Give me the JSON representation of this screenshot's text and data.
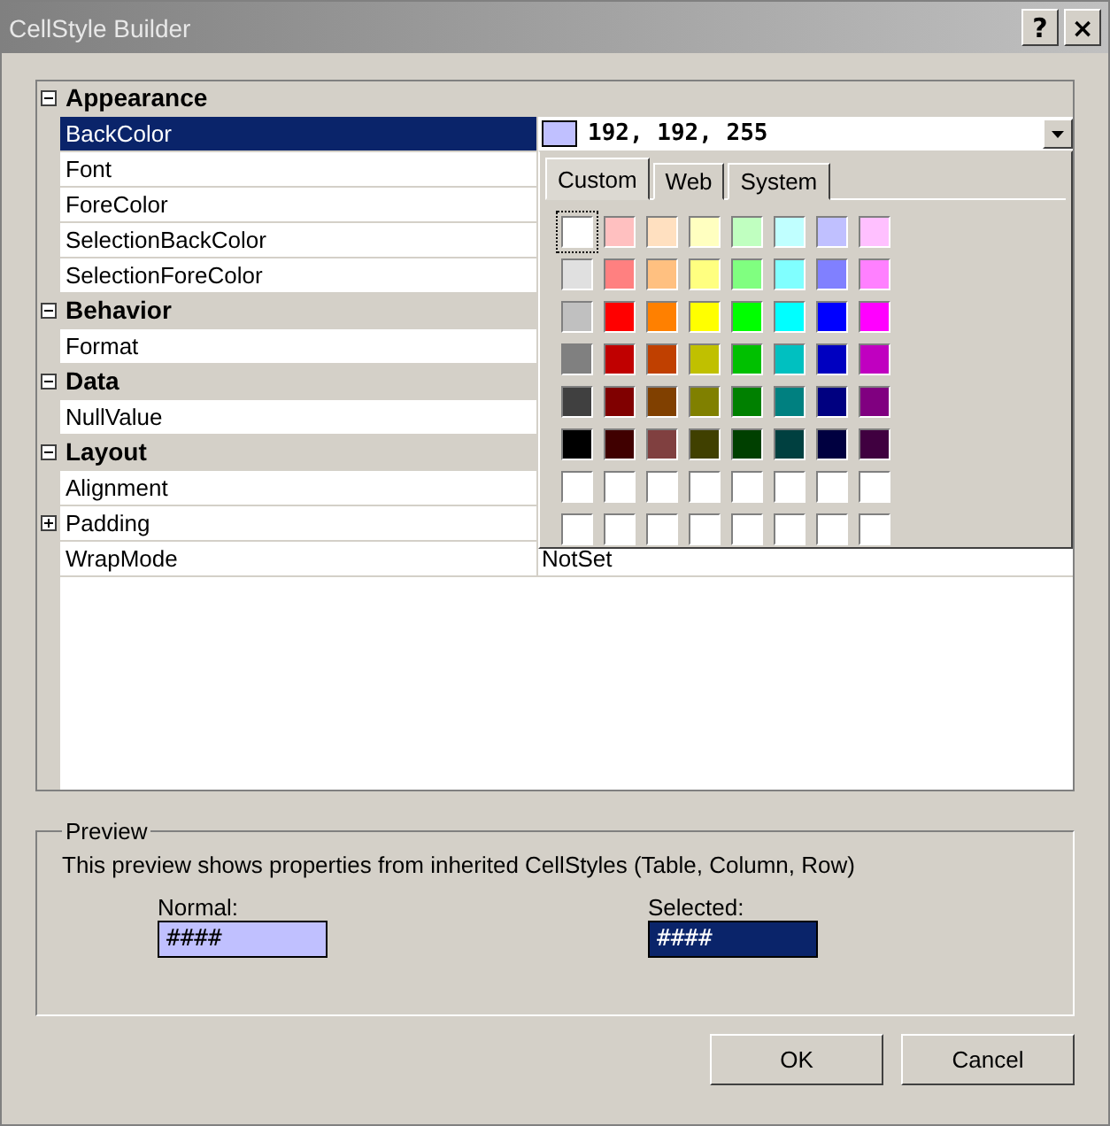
{
  "window": {
    "title": "CellStyle Builder",
    "help_button": "?",
    "close_button": "×"
  },
  "grid": {
    "sections": [
      {
        "name": "Appearance",
        "expanded": true,
        "properties": [
          {
            "name": "BackColor",
            "selected": true,
            "value": "192, 192, 255",
            "color": "#c0c0ff"
          },
          {
            "name": "Font",
            "selected": false
          },
          {
            "name": "ForeColor",
            "selected": false
          },
          {
            "name": "SelectionBackColor",
            "selected": false
          },
          {
            "name": "SelectionForeColor",
            "selected": false
          }
        ]
      },
      {
        "name": "Behavior",
        "expanded": true,
        "properties": [
          {
            "name": "Format",
            "selected": false
          }
        ]
      },
      {
        "name": "Data",
        "expanded": true,
        "properties": [
          {
            "name": "NullValue",
            "selected": false
          }
        ]
      },
      {
        "name": "Layout",
        "expanded": true,
        "properties": [
          {
            "name": "Alignment",
            "selected": false
          },
          {
            "name": "Padding",
            "selected": false,
            "expanded": false
          },
          {
            "name": "WrapMode",
            "selected": false,
            "value": "NotSet"
          }
        ]
      }
    ]
  },
  "color_picker": {
    "tabs": [
      {
        "label": "Custom",
        "selected": true
      },
      {
        "label": "Web",
        "selected": false
      },
      {
        "label": "System",
        "selected": false
      }
    ],
    "swatches": [
      {
        "color": "#ffffff",
        "selected": true
      },
      {
        "color": "#ffc0c0",
        "selected": false
      },
      {
        "color": "#ffe0c0",
        "selected": false
      },
      {
        "color": "#ffffc0",
        "selected": false
      },
      {
        "color": "#c0ffc0",
        "selected": false
      },
      {
        "color": "#c0ffff",
        "selected": false
      },
      {
        "color": "#c0c0ff",
        "selected": false
      },
      {
        "color": "#ffc0ff",
        "selected": false
      },
      {
        "color": "#e0e0e0",
        "selected": false
      },
      {
        "color": "#ff8080",
        "selected": false
      },
      {
        "color": "#ffc080",
        "selected": false
      },
      {
        "color": "#ffff80",
        "selected": false
      },
      {
        "color": "#80ff80",
        "selected": false
      },
      {
        "color": "#80ffff",
        "selected": false
      },
      {
        "color": "#8080ff",
        "selected": false
      },
      {
        "color": "#ff80ff",
        "selected": false
      },
      {
        "color": "#c0c0c0",
        "selected": false
      },
      {
        "color": "#ff0000",
        "selected": false
      },
      {
        "color": "#ff8000",
        "selected": false
      },
      {
        "color": "#ffff00",
        "selected": false
      },
      {
        "color": "#00ff00",
        "selected": false
      },
      {
        "color": "#00ffff",
        "selected": false
      },
      {
        "color": "#0000ff",
        "selected": false
      },
      {
        "color": "#ff00ff",
        "selected": false
      },
      {
        "color": "#808080",
        "selected": false
      },
      {
        "color": "#c00000",
        "selected": false
      },
      {
        "color": "#c04000",
        "selected": false
      },
      {
        "color": "#c0c000",
        "selected": false
      },
      {
        "color": "#00c000",
        "selected": false
      },
      {
        "color": "#00c0c0",
        "selected": false
      },
      {
        "color": "#0000c0",
        "selected": false
      },
      {
        "color": "#c000c0",
        "selected": false
      },
      {
        "color": "#404040",
        "selected": false
      },
      {
        "color": "#800000",
        "selected": false
      },
      {
        "color": "#804000",
        "selected": false
      },
      {
        "color": "#808000",
        "selected": false
      },
      {
        "color": "#008000",
        "selected": false
      },
      {
        "color": "#008080",
        "selected": false
      },
      {
        "color": "#000080",
        "selected": false
      },
      {
        "color": "#800080",
        "selected": false
      },
      {
        "color": "#000000",
        "selected": false
      },
      {
        "color": "#400000",
        "selected": false
      },
      {
        "color": "#804040",
        "selected": false
      },
      {
        "color": "#404000",
        "selected": false
      },
      {
        "color": "#004000",
        "selected": false
      },
      {
        "color": "#004040",
        "selected": false
      },
      {
        "color": "#000040",
        "selected": false
      },
      {
        "color": "#400040",
        "selected": false
      },
      {
        "color": "#ffffff",
        "selected": false
      },
      {
        "color": "#ffffff",
        "selected": false
      },
      {
        "color": "#ffffff",
        "selected": false
      },
      {
        "color": "#ffffff",
        "selected": false
      },
      {
        "color": "#ffffff",
        "selected": false
      },
      {
        "color": "#ffffff",
        "selected": false
      },
      {
        "color": "#ffffff",
        "selected": false
      },
      {
        "color": "#ffffff",
        "selected": false
      },
      {
        "color": "#ffffff",
        "selected": false
      },
      {
        "color": "#ffffff",
        "selected": false
      },
      {
        "color": "#ffffff",
        "selected": false
      },
      {
        "color": "#ffffff",
        "selected": false
      },
      {
        "color": "#ffffff",
        "selected": false
      },
      {
        "color": "#ffffff",
        "selected": false
      },
      {
        "color": "#ffffff",
        "selected": false
      },
      {
        "color": "#ffffff",
        "selected": false
      }
    ]
  },
  "preview": {
    "title": "Preview",
    "description": "This preview shows properties from inherited CellStyles (Table, Column, Row)",
    "samples": [
      {
        "label": "Normal:",
        "text": "####",
        "kind": "normal"
      },
      {
        "label": "Selected:",
        "text": "####",
        "kind": "selected"
      }
    ]
  },
  "buttons": [
    "OK",
    "Cancel"
  ]
}
